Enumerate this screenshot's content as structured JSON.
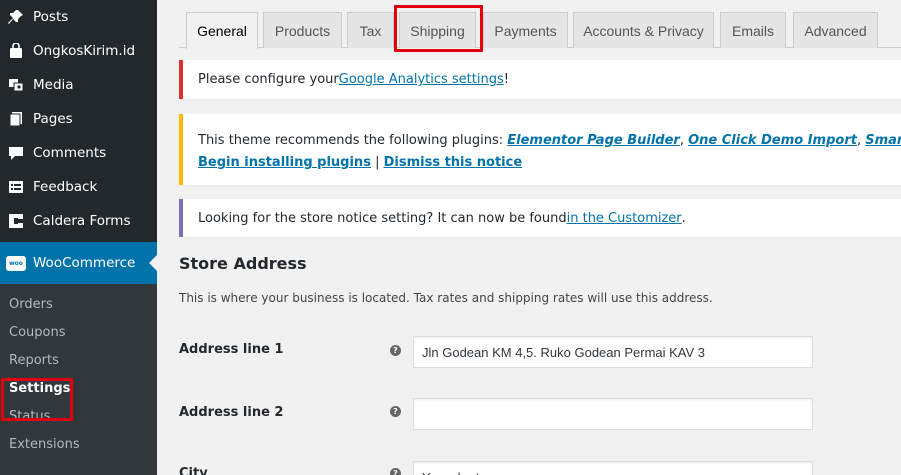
{
  "sidebar": {
    "menu": [
      {
        "label": "Posts",
        "icon": "pin-icon"
      },
      {
        "label": "OngkosKirim.id",
        "icon": "bag-icon"
      },
      {
        "label": "Media",
        "icon": "media-icon"
      },
      {
        "label": "Pages",
        "icon": "pages-icon"
      },
      {
        "label": "Comments",
        "icon": "comments-icon"
      },
      {
        "label": "Feedback",
        "icon": "feedback-icon"
      },
      {
        "label": "Caldera Forms",
        "icon": "caldera-icon"
      }
    ],
    "woocommerce": {
      "label": "WooCommerce",
      "logo_text": "woo"
    },
    "submenu": [
      {
        "label": "Orders"
      },
      {
        "label": "Coupons"
      },
      {
        "label": "Reports"
      },
      {
        "label": "Settings",
        "current": true
      },
      {
        "label": "Status"
      },
      {
        "label": "Extensions"
      }
    ]
  },
  "tabs": [
    "General",
    "Products",
    "Tax",
    "Shipping",
    "Payments",
    "Accounts & Privacy",
    "Emails",
    "Advanced"
  ],
  "active_tab": "General",
  "notices": {
    "analytics": {
      "prefix": "Please configure your ",
      "link": "Google Analytics settings",
      "suffix": "!"
    },
    "plugins": {
      "prefix": "This theme recommends the following plugins: ",
      "plugin1": "Elementor Page Builder",
      "plugin2": "One Click Demo Import",
      "plugin3": "Smart Variation Swatch",
      "sep": ", ",
      "begin": "Begin installing plugins",
      "divider": " | ",
      "dismiss": "Dismiss this notice"
    },
    "store_notice": {
      "prefix": "Looking for the store notice setting? It can now be found ",
      "link": "in the Customizer",
      "suffix": "."
    }
  },
  "store": {
    "title": "Store Address",
    "description": "This is where your business is located. Tax rates and shipping rates will use this address.",
    "fields": [
      {
        "label": "Address line 1",
        "value": "Jln Godean KM 4,5. Ruko Godean Permai KAV 3"
      },
      {
        "label": "Address line 2",
        "value": ""
      },
      {
        "label": "City",
        "value": "Yogyakarta"
      }
    ]
  },
  "help_glyph": "?",
  "colors": {
    "sidebar_bg": "#23282d",
    "submenu_bg": "#32373c",
    "accent": "#0073aa",
    "highlight_box": "#e0000b",
    "notice_error": "#dc3232",
    "notice_warning": "#ffb900",
    "notice_info": "#826eb4"
  }
}
